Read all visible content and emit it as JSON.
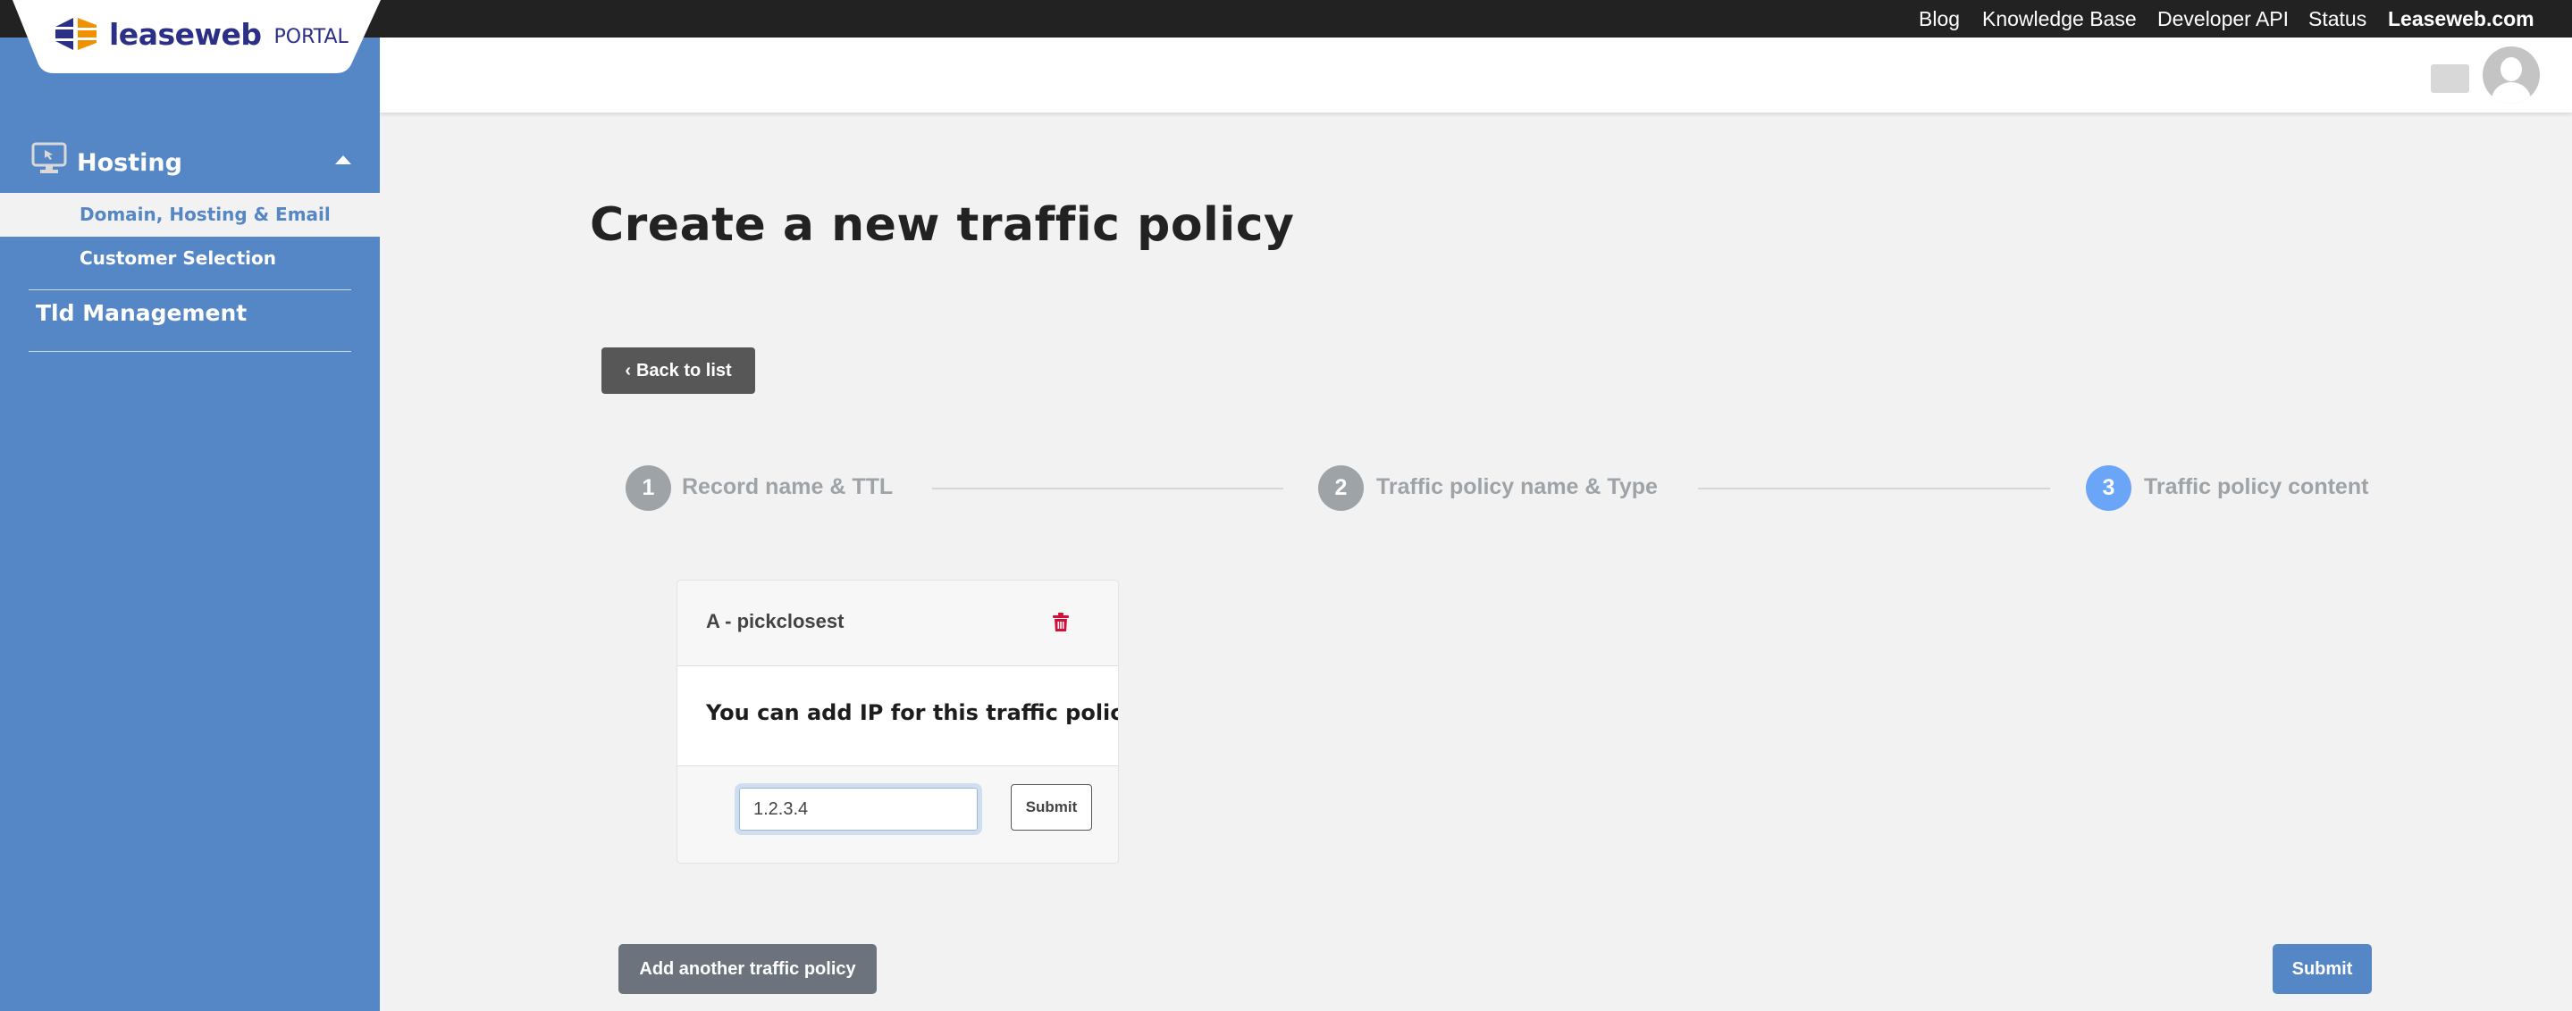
{
  "topnav": {
    "items": [
      "Blog",
      "Knowledge Base",
      "Developer API",
      "Status",
      "Leaseweb.com"
    ]
  },
  "brand": {
    "name": "leaseweb",
    "suffix": "PORTAL",
    "colors": {
      "blue": "#2b2f86",
      "orange": "#f29100"
    }
  },
  "sidebar": {
    "section": {
      "label": "Hosting",
      "icon": "monitor-icon",
      "expanded": true
    },
    "sub_items": [
      {
        "label": "Domain, Hosting & Email",
        "active": true
      },
      {
        "label": "Customer Selection",
        "active": false
      }
    ],
    "items": [
      {
        "label": "Tld Management"
      }
    ]
  },
  "header": {
    "avatar_icon": "user-avatar-icon"
  },
  "main": {
    "title": "Create a new traffic policy",
    "back_button": {
      "icon": "chevron-left-icon",
      "label": "Back to list"
    },
    "steps": [
      {
        "number": "1",
        "label": "Record name & TTL",
        "state": "done"
      },
      {
        "number": "2",
        "label": "Traffic policy name & Type",
        "state": "done"
      },
      {
        "number": "3",
        "label": "Traffic policy content",
        "state": "active"
      }
    ],
    "policy_card": {
      "title": "A - pickclosest",
      "delete_icon": "trash-icon",
      "description": "You can add IP for this traffic policy",
      "ip_input_value": "1.2.3.4",
      "submit_label": "Submit"
    },
    "add_button_label": "Add another traffic policy",
    "submit_label": "Submit"
  },
  "colors": {
    "sidebar": "#5586c5",
    "topbar": "#222222",
    "step_active": "#6aa5f7",
    "step_done": "#9ea3a8",
    "danger": "#d0103a"
  }
}
